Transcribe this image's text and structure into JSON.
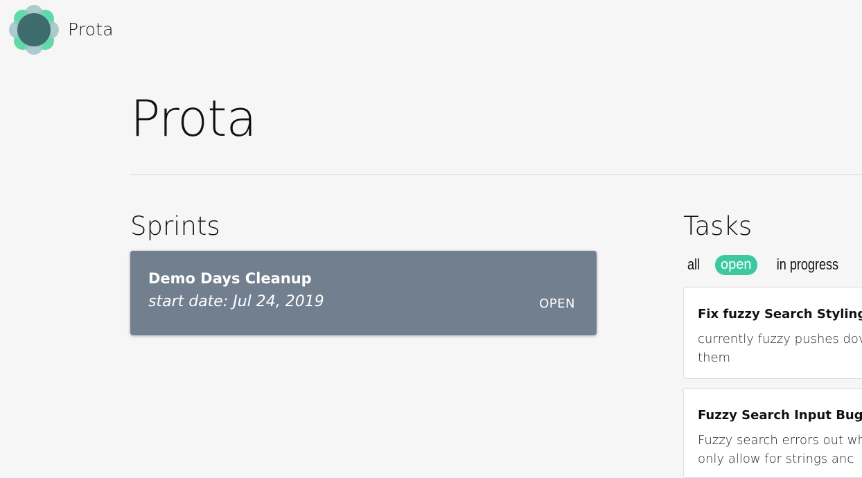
{
  "app": {
    "brand": "Prota",
    "logo_icon": "prota-logo-icon",
    "colors": {
      "logo_green": "#4fd6a0",
      "logo_slate": "#9ec3c6",
      "logo_center": "#3e6b6c",
      "sprint_card_bg": "#717f8e",
      "accent": "#3cc9a0",
      "page_bg": "#f6f6f6"
    }
  },
  "page": {
    "title": "Prota"
  },
  "sprints": {
    "heading": "Sprints",
    "items": [
      {
        "name": "Demo Days Cleanup",
        "start_date": "start date: Jul 24, 2019",
        "status": "OPEN"
      }
    ]
  },
  "tasks": {
    "heading": "Tasks",
    "filters": {
      "all": "all",
      "open": "open",
      "in_progress": "in progress",
      "selected": "open"
    },
    "items": [
      {
        "title": "Fix fuzzy Search Styling",
        "description": "currently fuzzy pushes dov them"
      },
      {
        "title": "Fuzzy Search Input Bug",
        "description": "Fuzzy search errors out wh to only allow for strings anc"
      }
    ]
  }
}
